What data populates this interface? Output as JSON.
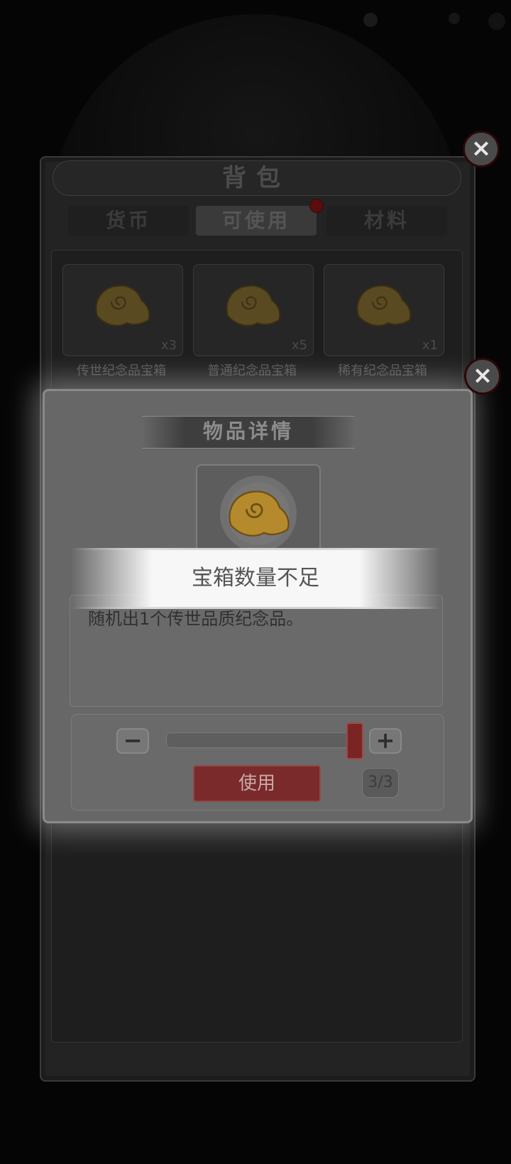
{
  "bag": {
    "title": "背包",
    "tabs": [
      {
        "label": "货币",
        "active": false
      },
      {
        "label": "可使用",
        "active": true,
        "has_badge": true
      },
      {
        "label": "材料",
        "active": false
      }
    ],
    "items": [
      {
        "name": "传世纪念品宝箱",
        "count": "x3",
        "icon": "shell-chest-icon"
      },
      {
        "name": "普通纪念品宝箱",
        "count": "x5",
        "icon": "shell-chest-icon"
      },
      {
        "name": "稀有纪念品宝箱",
        "count": "x1",
        "icon": "shell-chest-icon"
      }
    ]
  },
  "detail": {
    "title": "物品详情",
    "item_icon": "shell-chest-icon",
    "description": "随机出1个传世品质纪念品。",
    "minus_label": "−",
    "plus_label": "+",
    "slider_fraction": 1.0,
    "use_label": "使用",
    "count_label": "3/3"
  },
  "toast": {
    "message": "宝箱数量不足"
  },
  "icons": {
    "close": "×"
  },
  "colors": {
    "accent_red": "#7a2a2a",
    "gold": "#e0a530"
  }
}
